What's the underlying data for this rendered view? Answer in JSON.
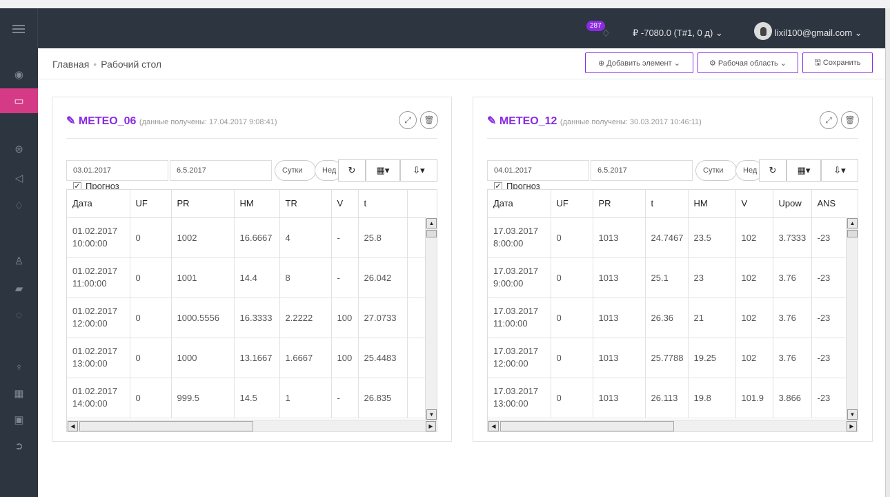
{
  "topbar": {
    "notifications": "287",
    "balance": "₽ -7080.0 (Т#1, 0 д) ⌄",
    "email": "lixil100@gmail.com ⌄"
  },
  "breadcrumb": {
    "home": "Главная",
    "sep": "•",
    "current": "Рабочий стол"
  },
  "toolbar": {
    "add_element": "⊕ Добавить элемент ⌄",
    "workspace": "⚙ Рабочая область ⌄",
    "save": "🖫 Сохранить"
  },
  "panels": [
    {
      "title": "METEO_06",
      "subtitle": "(данные получены: 17.04.2017 9:08:41)",
      "date_from": "03.01.2017",
      "date_to": "6.5.2017",
      "pill_day": "Сутки",
      "pill_week": "Нед",
      "forecast_label": "Прогноз",
      "columns": [
        "Дата",
        "UF",
        "PR",
        "HM",
        "TR",
        "V",
        "t"
      ],
      "rows": [
        [
          "01.02.2017 10:00:00",
          "0",
          "1002",
          "16.6667",
          "4",
          "-",
          "25.8"
        ],
        [
          "01.02.2017 11:00:00",
          "0",
          "1001",
          "14.4",
          "8",
          "-",
          "26.042"
        ],
        [
          "01.02.2017 12:00:00",
          "0",
          "1000.5556",
          "16.3333",
          "2.2222",
          "100",
          "27.0733"
        ],
        [
          "01.02.2017 13:00:00",
          "0",
          "1000",
          "13.1667",
          "1.6667",
          "100",
          "25.4483"
        ],
        [
          "01.02.2017 14:00:00",
          "0",
          "999.5",
          "14.5",
          "1",
          "-",
          "26.835"
        ]
      ]
    },
    {
      "title": "METEO_12",
      "subtitle": "(данные получены: 30.03.2017 10:46:11)",
      "date_from": "04.01.2017",
      "date_to": "6.5.2017",
      "pill_day": "Сутки",
      "pill_week": "Нед",
      "forecast_label": "Прогноз",
      "columns": [
        "Дата",
        "UF",
        "PR",
        "t",
        "HM",
        "V",
        "Upow",
        "ANS"
      ],
      "rows": [
        [
          "17.03.2017 8:00:00",
          "0",
          "1013",
          "24.7467",
          "23.5",
          "102",
          "3.7333",
          "-23"
        ],
        [
          "17.03.2017 9:00:00",
          "0",
          "1013",
          "25.1",
          "23",
          "102",
          "3.76",
          "-23"
        ],
        [
          "17.03.2017 11:00:00",
          "0",
          "1013",
          "26.36",
          "21",
          "102",
          "3.76",
          "-23"
        ],
        [
          "17.03.2017 12:00:00",
          "0",
          "1013",
          "25.7788",
          "19.25",
          "102",
          "3.76",
          "-23"
        ],
        [
          "17.03.2017 13:00:00",
          "0",
          "1013",
          "26.113",
          "19.8",
          "101.9",
          "3.866",
          "-23"
        ]
      ]
    }
  ]
}
